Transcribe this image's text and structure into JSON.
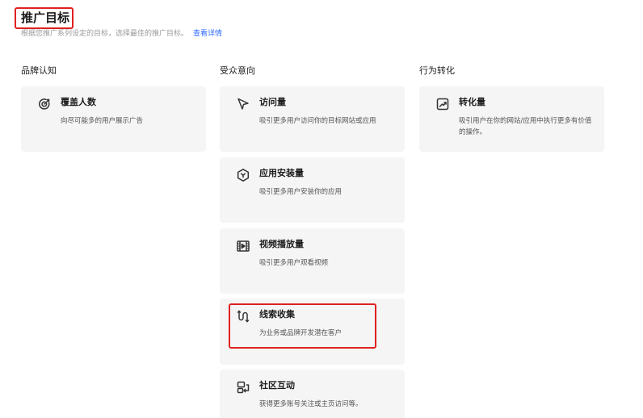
{
  "header": {
    "title": "推广目标",
    "subtitle": "根据您推广系列设定的目标，选择最佳的推广目标。",
    "link": "查看详情"
  },
  "columns": [
    {
      "label": "品牌认知",
      "cards": [
        {
          "title": "覆盖人数",
          "desc": "向尽可能多的用户展示广告",
          "icon": "reach-target-icon"
        }
      ]
    },
    {
      "label": "受众意向",
      "cards": [
        {
          "title": "访问量",
          "desc": "吸引更多用户访问你的目标网站或应用",
          "icon": "cursor-arrow-icon"
        },
        {
          "title": "应用安装量",
          "desc": "吸引更多用户安装你的应用",
          "icon": "app-install-cube-icon"
        },
        {
          "title": "视频播放量",
          "desc": "吸引更多用户观看视频",
          "icon": "video-film-icon"
        },
        {
          "title": "线索收集",
          "desc": "为业务或品牌开发潜在客户",
          "icon": "lead-funnel-icon"
        },
        {
          "title": "社区互动",
          "desc": "获得更多账号关注或主页访问等。",
          "icon": "community-icon"
        }
      ]
    },
    {
      "label": "行为转化",
      "cards": [
        {
          "title": "转化量",
          "desc": "吸引用户在你的网站/应用中执行更多有价值的操作。",
          "icon": "trend-chart-icon"
        }
      ]
    }
  ],
  "annotations": {
    "highlight_color": "#e02020",
    "link_color": "#2f6bff",
    "card_bg": "#f5f5f5"
  }
}
